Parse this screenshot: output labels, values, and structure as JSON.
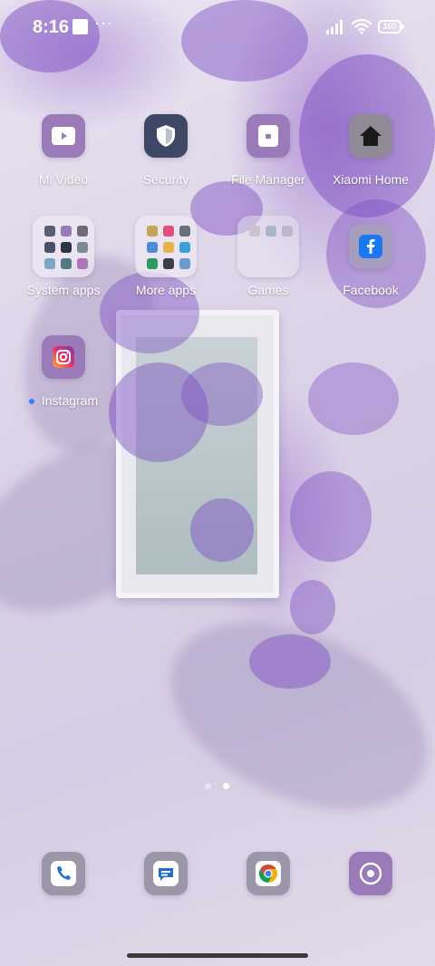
{
  "status_bar": {
    "time": "8:16",
    "more": "···",
    "battery": "100"
  },
  "apps": [
    {
      "label": "Mi Video",
      "icon": "play-icon"
    },
    {
      "label": "Security",
      "icon": "shield-icon"
    },
    {
      "label": "File Manager",
      "icon": "folder-icon"
    },
    {
      "label": "Xiaomi Home",
      "icon": "house-icon"
    },
    {
      "label": "System apps",
      "icon": "folder-grid-icon"
    },
    {
      "label": "More apps",
      "icon": "folder-grid-icon"
    },
    {
      "label": "Games",
      "icon": "folder-grid-icon"
    },
    {
      "label": "Facebook",
      "icon": "facebook-icon"
    },
    {
      "label": "Instagram",
      "icon": "instagram-icon"
    }
  ],
  "dock": [
    {
      "icon": "phone-icon"
    },
    {
      "icon": "messages-icon"
    },
    {
      "icon": "chrome-icon"
    },
    {
      "icon": "camera-icon"
    }
  ],
  "pager": {
    "pages": 2,
    "current": 2
  },
  "colors": {
    "accent_purple": "#9a7ab8",
    "security_navy": "#3d4766",
    "facebook_blue": "#1877f2",
    "new_badge": "#3b7bff"
  }
}
